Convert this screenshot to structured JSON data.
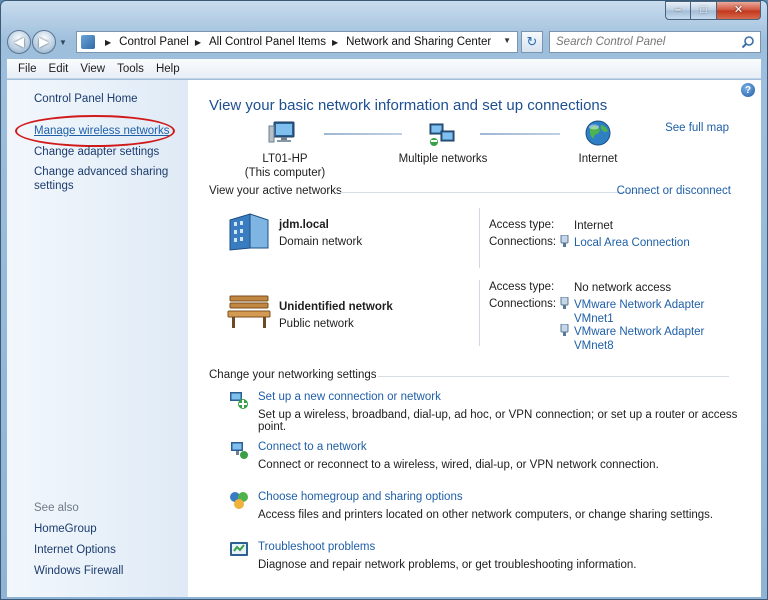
{
  "window": {
    "caption": {
      "minimize": "–",
      "maximize": "□",
      "close": "✕"
    }
  },
  "address_bar": {
    "breadcrumbs": [
      "Control Panel",
      "All Control Panel Items",
      "Network and Sharing Center"
    ],
    "search_placeholder": "Search Control Panel"
  },
  "menu": [
    "File",
    "Edit",
    "View",
    "Tools",
    "Help"
  ],
  "left_pane": {
    "home": "Control Panel Home",
    "links": [
      "Manage wireless networks",
      "Change adapter settings",
      "Change advanced sharing settings"
    ],
    "see_also_title": "See also",
    "see_also": [
      "HomeGroup",
      "Internet Options",
      "Windows Firewall"
    ]
  },
  "main": {
    "heading": "View your basic network information and set up connections",
    "see_full_map": "See full map",
    "map": {
      "computer_name": "LT01-HP",
      "computer_sub": "(This computer)",
      "middle": "Multiple networks",
      "internet": "Internet"
    },
    "active_title": "View your active networks",
    "connect_disconnect": "Connect or disconnect",
    "networks": [
      {
        "name": "jdm.local",
        "type": "Domain network",
        "access_label": "Access type:",
        "access": "Internet",
        "connections_label": "Connections:",
        "connections": [
          "Local Area Connection"
        ]
      },
      {
        "name": "Unidentified network",
        "type": "Public network",
        "access_label": "Access type:",
        "access": "No network access",
        "connections_label": "Connections:",
        "connections": [
          "VMware Network Adapter",
          "VMnet1",
          "VMware Network Adapter",
          "VMnet8"
        ]
      }
    ],
    "settings_title": "Change your networking settings",
    "tasks": [
      {
        "link": "Set up a new connection or network",
        "desc": "Set up a wireless, broadband, dial-up, ad hoc, or VPN connection; or set up a router or access point."
      },
      {
        "link": "Connect to a network",
        "desc": "Connect or reconnect to a wireless, wired, dial-up, or VPN network connection."
      },
      {
        "link": "Choose homegroup and sharing options",
        "desc": "Access files and printers located on other network computers, or change sharing settings."
      },
      {
        "link": "Troubleshoot problems",
        "desc": "Diagnose and repair network problems, or get troubleshooting information."
      }
    ]
  }
}
